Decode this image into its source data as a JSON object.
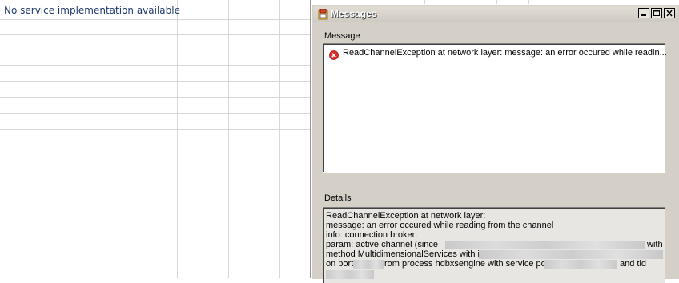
{
  "sheet": {
    "cell_a1": "No service implementation available"
  },
  "dialog": {
    "title": "Messages",
    "message_label": "Message",
    "message_text": "ReadChannelException at network layer:   message: an error occured while readin...",
    "details_label": "Details",
    "details_lines": [
      "ReadChannelException at network layer:",
      "  message: an error occured while reading from the channel",
      "  info:    connection broken",
      "  param:   active channel (since",
      "with",
      "method MultidimensionalServices with id",
      "on port",
      "rom process hdbxsengine with service port",
      "and tid"
    ],
    "icons": {
      "app": "messages-app-icon",
      "minimize": "minimize-icon",
      "maximize": "maximize-icon",
      "close": "close-icon",
      "error": "error-icon"
    },
    "colors": {
      "error_red": "#e0302a",
      "window_face": "#d4d0c8"
    }
  }
}
